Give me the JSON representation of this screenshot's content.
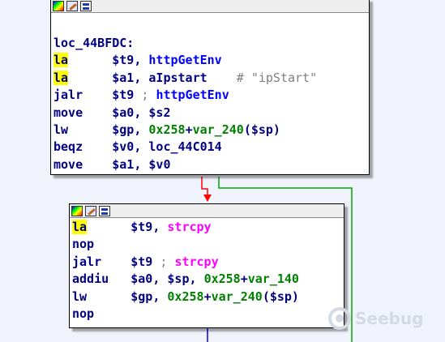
{
  "blocks": [
    {
      "label": "loc_44BFDC:",
      "lines": [
        {
          "mnemonic": "la",
          "highlight": true,
          "operands": [
            {
              "t": "$t9, ",
              "k": "reg"
            },
            {
              "t": "httpGetEnv",
              "k": "sym"
            }
          ]
        },
        {
          "mnemonic": "la",
          "highlight": true,
          "operands": [
            {
              "t": "$a1, ",
              "k": "reg"
            },
            {
              "t": "aIpstart",
              "k": "reg"
            },
            {
              "t": "    # \"ipStart\"",
              "k": "cmt"
            }
          ]
        },
        {
          "mnemonic": "jalr",
          "highlight": false,
          "operands": [
            {
              "t": "$t9 ",
              "k": "reg"
            },
            {
              "t": "; ",
              "k": "cmt"
            },
            {
              "t": "httpGetEnv",
              "k": "sym"
            }
          ]
        },
        {
          "mnemonic": "move",
          "highlight": false,
          "operands": [
            {
              "t": "$a0, $s2",
              "k": "reg"
            }
          ]
        },
        {
          "mnemonic": "lw",
          "highlight": false,
          "operands": [
            {
              "t": "$gp, ",
              "k": "reg"
            },
            {
              "t": "0x258",
              "k": "num"
            },
            {
              "t": "+",
              "k": "reg"
            },
            {
              "t": "var_240",
              "k": "num"
            },
            {
              "t": "($sp)",
              "k": "reg"
            }
          ]
        },
        {
          "mnemonic": "beqz",
          "highlight": false,
          "operands": [
            {
              "t": "$v0, ",
              "k": "reg"
            },
            {
              "t": "loc_44C014",
              "k": "reg"
            }
          ]
        },
        {
          "mnemonic": "move",
          "highlight": false,
          "operands": [
            {
              "t": "$a1, $v0",
              "k": "reg"
            }
          ]
        }
      ]
    },
    {
      "label": "",
      "lines": [
        {
          "mnemonic": "la",
          "highlight": true,
          "operands": [
            {
              "t": "$t9, ",
              "k": "reg"
            },
            {
              "t": "strcpy",
              "k": "fn"
            }
          ]
        },
        {
          "mnemonic": "nop",
          "highlight": false,
          "operands": []
        },
        {
          "mnemonic": "jalr",
          "highlight": false,
          "operands": [
            {
              "t": "$t9 ",
              "k": "reg"
            },
            {
              "t": "; ",
              "k": "cmt"
            },
            {
              "t": "strcpy",
              "k": "fn"
            }
          ]
        },
        {
          "mnemonic": "addiu",
          "highlight": false,
          "operands": [
            {
              "t": "$a0, $sp, ",
              "k": "reg"
            },
            {
              "t": "0x258",
              "k": "num"
            },
            {
              "t": "+",
              "k": "reg"
            },
            {
              "t": "var_140",
              "k": "num"
            }
          ]
        },
        {
          "mnemonic": "lw",
          "highlight": false,
          "operands": [
            {
              "t": "$gp, ",
              "k": "reg"
            },
            {
              "t": "0x258",
              "k": "num"
            },
            {
              "t": "+",
              "k": "reg"
            },
            {
              "t": "var_240",
              "k": "num"
            },
            {
              "t": "($sp)",
              "k": "reg"
            }
          ]
        },
        {
          "mnemonic": "nop",
          "highlight": false,
          "operands": []
        }
      ]
    }
  ],
  "toolbar_icons": [
    "color-palette-icon",
    "edit-pencil-icon",
    "graph-view-icon"
  ],
  "watermark": {
    "text": "Seebug"
  },
  "colors": {
    "background": "#f0f3fb",
    "edge_false": "#ff0000",
    "edge_true": "#00aa00",
    "edge_normal": "#0000ff",
    "highlight": "#ffff00"
  }
}
